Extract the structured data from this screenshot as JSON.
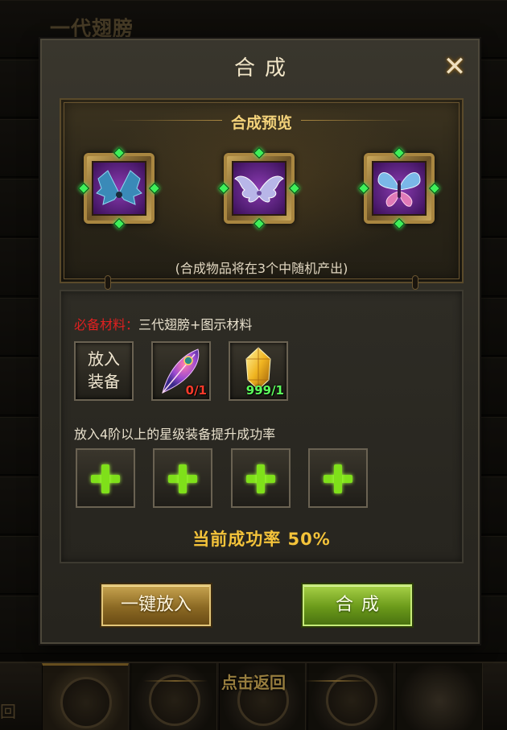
{
  "background": {
    "title": "一代翅膀",
    "return_text": "点击返回",
    "return_tag": "回"
  },
  "dialog": {
    "title": "合成",
    "close_glyph": "✕"
  },
  "preview": {
    "heading": "合成预览",
    "note": "(合成物品将在3个中随机产出)",
    "items": [
      {
        "icon": "dark-bat-wings-icon",
        "wing_color": "#5ab4d8"
      },
      {
        "icon": "white-feather-wings-icon",
        "wing_color": "#c8c4f0"
      },
      {
        "icon": "butterfly-wings-icon",
        "wing_color": "#e07ab8"
      }
    ]
  },
  "materials": {
    "required_label": "必备材料：",
    "required_value": "三代翅膀+图示材料",
    "slots": [
      {
        "text_line1": "放入",
        "text_line2": "装备"
      },
      {
        "icon": "phoenix-feather-icon",
        "count": "0/1",
        "count_color": "#ff3a2a"
      },
      {
        "icon": "gold-crystal-icon",
        "count": "999/1",
        "count_color": "#5cff5c"
      }
    ],
    "hint": "放入4阶以上的星级装备提升成功率",
    "plus_slots": 4,
    "rate_label": "当前成功率",
    "rate_value": "50%",
    "rate_display": "当前成功率  50%"
  },
  "buttons": {
    "auto_fill": "一键放入",
    "combine": "合成"
  },
  "colors": {
    "gold_text": "#f4c33a",
    "required_red": "#e02020",
    "plus_green": "#7fe01a"
  }
}
